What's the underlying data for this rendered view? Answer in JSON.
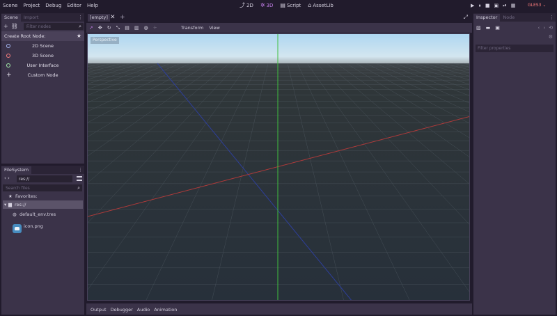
{
  "menu": [
    "Scene",
    "Project",
    "Debug",
    "Editor",
    "Help"
  ],
  "workspaces": [
    {
      "icon": "2d-icon",
      "glyph": "⤴",
      "label": "2D",
      "active": false
    },
    {
      "icon": "3d-icon",
      "glyph": "✲",
      "label": "3D",
      "active": true
    },
    {
      "icon": "script-icon",
      "glyph": "▤",
      "label": "Script",
      "active": false
    },
    {
      "icon": "assetlib-icon",
      "glyph": "⌂",
      "label": "AssetLib",
      "active": false
    }
  ],
  "play_buttons": [
    "▶",
    "⏸",
    "■",
    "▣",
    "⏯",
    "▦"
  ],
  "renderer": "GLES3 ⌄",
  "scene_dock": {
    "tabs": [
      "Scene",
      "Import"
    ],
    "filter_placeholder": "Filter nodes",
    "create_root": "Create Root Node:",
    "nodes": [
      {
        "label": "2D Scene",
        "color": "#a5b7f3"
      },
      {
        "label": "3D Scene",
        "color": "#fc7f7f"
      },
      {
        "label": "User Interface",
        "color": "#a5efac"
      },
      {
        "label": "Custom Node",
        "color": ""
      }
    ]
  },
  "filesystem": {
    "tab": "FileSystem",
    "path": "res://",
    "search_placeholder": "Search files",
    "favorites": "Favorites:",
    "root": "res://",
    "files": [
      "default_env.tres",
      "icon.png"
    ]
  },
  "editor": {
    "scene_tab": "[empty]",
    "toolbar_menus": [
      "Transform",
      "View"
    ],
    "viewport_label": "Perspective",
    "bottom_tabs": [
      "Output",
      "Debugger",
      "Audio",
      "Animation"
    ]
  },
  "inspector": {
    "tabs": [
      "Inspector",
      "Node"
    ],
    "filter_placeholder": "Filter properties"
  },
  "colors": {
    "accent": "#c27ee8",
    "x_axis": "#b03a3a",
    "y_axis": "#3fbf3f",
    "z_axis": "#2e3f9a"
  }
}
